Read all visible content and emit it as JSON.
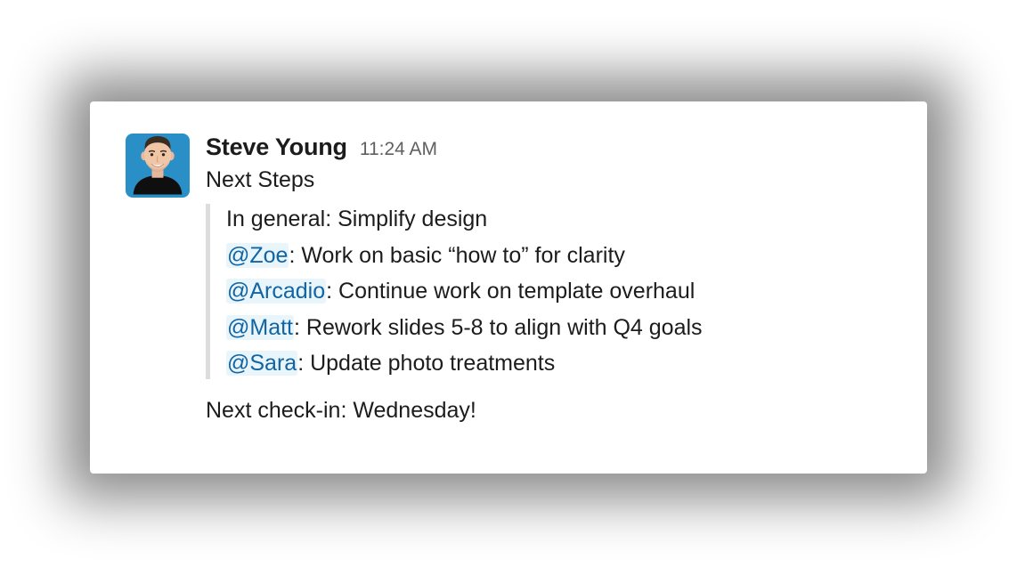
{
  "message": {
    "author": "Steve Young",
    "timestamp": "11:24 AM",
    "intro": "Next Steps",
    "quote": {
      "general": "In general: Simplify design",
      "items": [
        {
          "mention": "@Zoe",
          "task": ": Work on basic “how to” for clarity"
        },
        {
          "mention": "@Arcadio",
          "task": ": Continue work on template overhaul"
        },
        {
          "mention": "@Matt",
          "task": ": Rework slides 5-8 to align with Q4 goals"
        },
        {
          "mention": "@Sara",
          "task": ": Update photo treatments"
        }
      ]
    },
    "footer": "Next check-in: Wednesday!"
  }
}
